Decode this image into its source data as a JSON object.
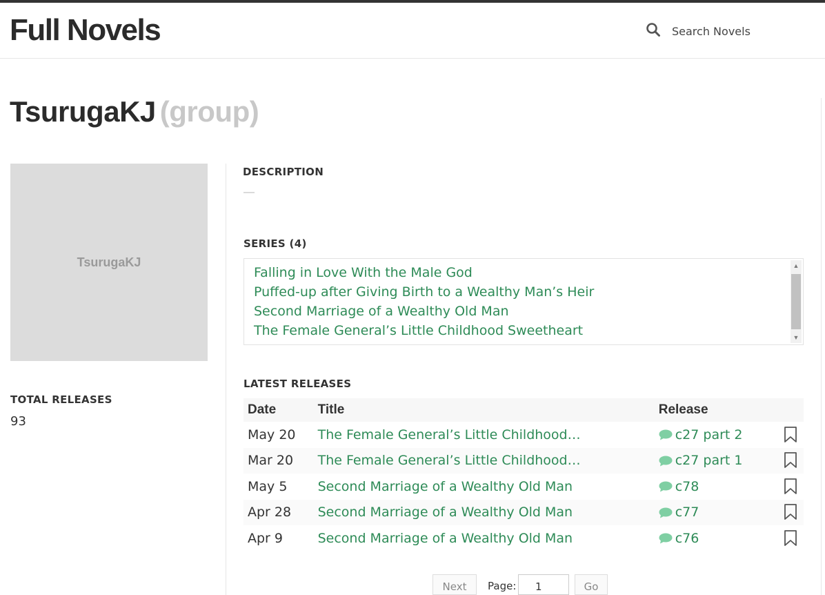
{
  "header": {
    "logo": "Full Novels",
    "search_placeholder": "Search Novels"
  },
  "page": {
    "title": "TsurugaKJ",
    "title_suffix": "(group)"
  },
  "sidebar": {
    "avatar_text": "TsurugaKJ",
    "total_releases_label": "TOTAL RELEASES",
    "total_releases_value": "93"
  },
  "description": {
    "label": "DESCRIPTION",
    "value": "—"
  },
  "series": {
    "label": "SERIES (4)",
    "items": [
      "Falling in Love With the Male God",
      "Puffed-up after Giving Birth to a Wealthy Man’s Heir",
      "Second Marriage of a Wealthy Old Man",
      "The Female General’s Little Childhood Sweetheart"
    ]
  },
  "releases": {
    "label": "LATEST RELEASES",
    "columns": [
      "Date",
      "Title",
      "Release"
    ],
    "rows": [
      {
        "date": "May 20",
        "title": "The Female General’s Little Childhood…",
        "release": "c27 part 2"
      },
      {
        "date": "Mar 20",
        "title": "The Female General’s Little Childhood…",
        "release": "c27 part 1"
      },
      {
        "date": "May 5",
        "title": "Second Marriage of a Wealthy Old Man",
        "release": "c78"
      },
      {
        "date": "Apr 28",
        "title": "Second Marriage of a Wealthy Old Man",
        "release": "c77"
      },
      {
        "date": "Apr 9",
        "title": "Second Marriage of a Wealthy Old Man",
        "release": "c76"
      }
    ]
  },
  "pager": {
    "next_label": "Next",
    "page_label": "Page:",
    "page_value": "1",
    "go_label": "Go"
  },
  "colors": {
    "link": "#2e8b57",
    "comment_icon": "#7fcfa3",
    "avatar_bg": "#dcdcdc"
  }
}
